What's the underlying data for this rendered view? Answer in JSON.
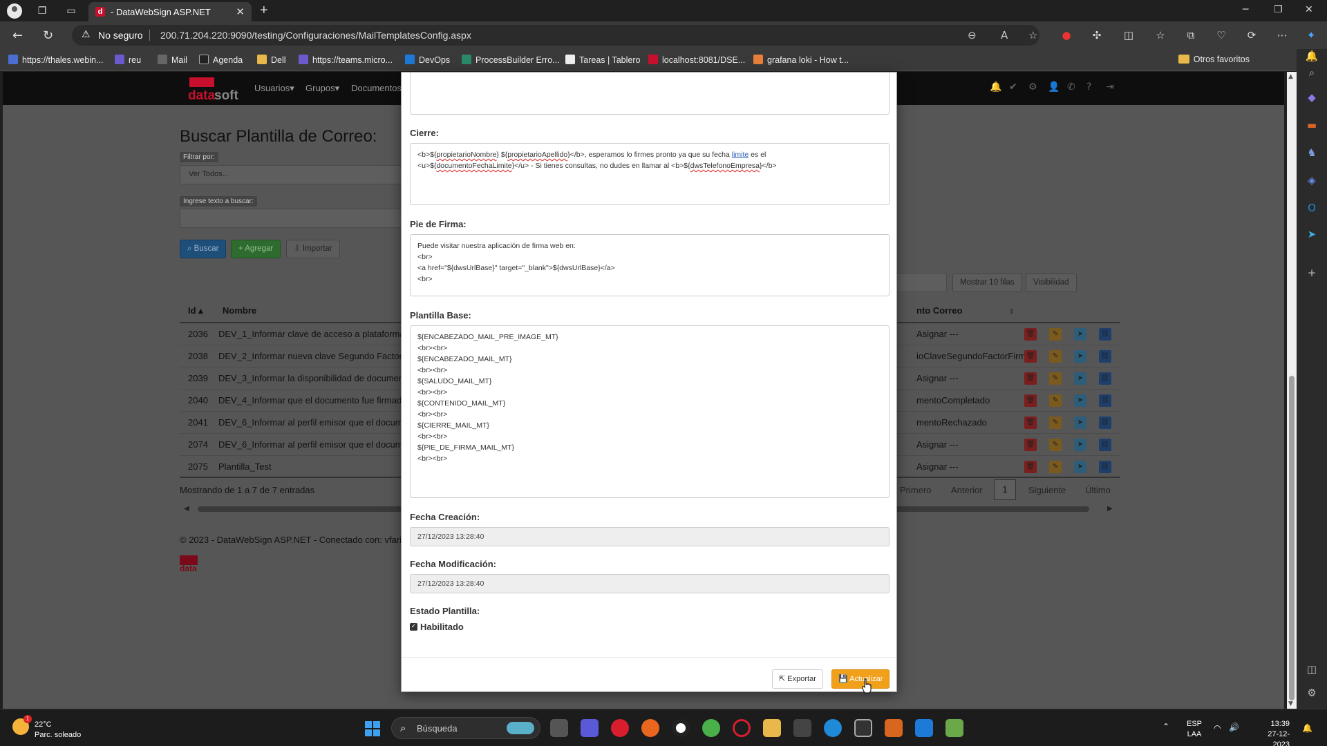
{
  "browser": {
    "tab_title": "- DataWebSign ASP.NET",
    "security_label": "No seguro",
    "url": "200.71.204.220:9090/testing/Configuraciones/MailTemplatesConfig.aspx",
    "bookmarks": [
      "https://thales.webin...",
      "reu",
      "Mail",
      "Agenda",
      "Dell",
      "https://teams.micro...",
      "DevOps",
      "ProcessBuilder Erro...",
      "Tareas | Tablero",
      "localhost:8081/DSE...",
      "grafana loki - How t..."
    ],
    "other_favorites": "Otros favoritos"
  },
  "app": {
    "logo_a": "data",
    "logo_b": "soft",
    "menu": [
      "Usuarios",
      "Grupos",
      "Documentos"
    ],
    "page_title": "Buscar Plantilla de Correo:",
    "filter_label": "Filtrar por:",
    "filter_value": "Ver Todos...",
    "search_label": "Ingrese texto a buscar:",
    "buttons": {
      "buscar": "Buscar",
      "agregar": "Agregar",
      "importar": "Importar",
      "mostrar": "Mostrar 10 filas",
      "visibilidad": "Visibilidad"
    },
    "table": {
      "headers": {
        "id": "Id",
        "nombre": "Nombre",
        "correo": "nto Correo"
      },
      "rows": [
        {
          "id": "2036",
          "nombre": "DEV_1_Informar clave de acceso a plataforma",
          "correo": "Asignar ---"
        },
        {
          "id": "2038",
          "nombre": "DEV_2_Informar nueva clave Segundo Factor I",
          "correo": "ioClaveSegundoFactorFirma"
        },
        {
          "id": "2039",
          "nombre": "DEV_3_Informar la disponibilidad de document",
          "correo": "Asignar ---"
        },
        {
          "id": "2040",
          "nombre": "DEV_4_Informar que el documento fue firmado",
          "correo": "mentoCompletado"
        },
        {
          "id": "2041",
          "nombre": "DEV_6_Informar al perfil emisor que el docume",
          "correo": "mentoRechazado"
        },
        {
          "id": "2074",
          "nombre": "DEV_6_Informar al perfil emisor que el docume",
          "correo": "Asignar ---"
        },
        {
          "id": "2075",
          "nombre": "Plantilla_Test",
          "correo": "Asignar ---"
        }
      ]
    },
    "showing": "Mostrando de 1 a 7 de 7 entradas",
    "pager": {
      "first": "Primero",
      "prev": "Anterior",
      "current": "1",
      "next": "Siguiente",
      "last": "Último"
    },
    "footer": "© 2023 - DataWebSign ASP.NET - Conectado con: vfari"
  },
  "modal": {
    "cierre_label": "Cierre:",
    "cierre_line1_parts": [
      "<b>${",
      "propietarioNombre",
      "} ${",
      "propietarioApellido",
      "}</b>, esperamos lo firmes pronto ya que su fecha ",
      "limite",
      " es el"
    ],
    "cierre_line2_parts": [
      "<u>${",
      "documentoFechaLimite",
      "}</u> - Si tienes consultas, no dudes en llamar al <b>${",
      "dwsTelefonoEmpresa",
      "}</b>"
    ],
    "pie_label": "Pie de Firma:",
    "pie_text": "Puede visitar nuestra aplicación de firma web en:\n<br>\n<a href=\"${dwsUrlBase}\" target=\"_blank\">${dwsUrlBase}</a>\n<br>",
    "base_label": "Plantilla Base:",
    "base_text": "${ENCABEZADO_MAIL_PRE_IMAGE_MT}\n<br><br>\n${ENCABEZADO_MAIL_MT}\n<br><br>\n${SALUDO_MAIL_MT}\n<br><br>\n${CONTENIDO_MAIL_MT}\n<br><br>\n${CIERRE_MAIL_MT}\n<br><br>\n${PIE_DE_FIRMA_MAIL_MT}\n<br><br>",
    "creacion_label": "Fecha Creación:",
    "creacion_value": "27/12/2023 13:28:40",
    "modificacion_label": "Fecha Modificación:",
    "modificacion_value": "27/12/2023 13:28:40",
    "estado_label": "Estado Plantilla:",
    "habilitado_label": "Habilitado",
    "habilitado_checked": true,
    "export_label": "Exportar",
    "update_label": "Actualizar"
  },
  "taskbar": {
    "temp": "22°C",
    "weather": "Parc. soleado",
    "weather_badge": "1",
    "search_placeholder": "Búsqueda",
    "lang1": "ESP",
    "lang2": "LAA",
    "time": "13:39",
    "date": "27-12-2023"
  },
  "colors": {
    "accent_orange": "#f0a01a",
    "brand_red": "#c8102e",
    "edge_bg": "#3a3a3a"
  }
}
